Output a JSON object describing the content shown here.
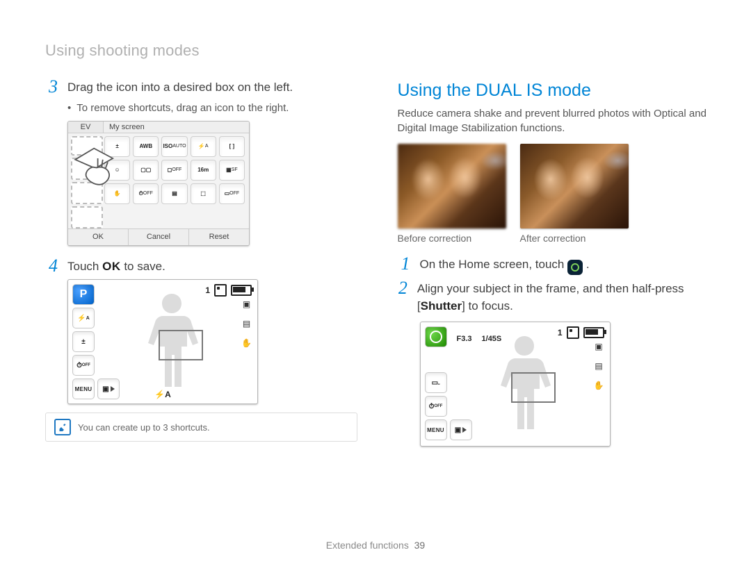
{
  "header": "Using shooting modes",
  "left": {
    "step3": {
      "num": "3",
      "text": "Drag the icon into a desired box on the left.",
      "bullet": "To remove shortcuts, drag an icon to the right."
    },
    "myscreen": {
      "ev": "EV",
      "title": "My screen",
      "buttons": {
        "ok": "OK",
        "cancel": "Cancel",
        "reset": "Reset"
      },
      "icons": [
        "EV",
        "AWB",
        "ISO",
        "flash",
        "focus",
        "face",
        "drive",
        "off",
        "16m",
        "size",
        "dual",
        "timer",
        "pal",
        "area",
        "off2"
      ]
    },
    "step4": {
      "num": "4",
      "text_before": "Touch ",
      "ok": "OK",
      "text_after": " to save."
    },
    "lcd1": {
      "mode": "P",
      "menu": "MENU",
      "count": "1",
      "flash": "⚡A"
    },
    "note": "You can create up to 3 shortcuts."
  },
  "right": {
    "title": "Using the DUAL IS mode",
    "desc": "Reduce camera shake and prevent blurred photos with Optical and Digital Image Stabilization functions.",
    "captions": {
      "before": "Before correction",
      "after": "After correction"
    },
    "step1": {
      "num": "1",
      "text_before": "On the Home screen, touch ",
      "text_after": "."
    },
    "step2": {
      "num": "2",
      "text_before": "Align your subject in the frame, and then half-press [",
      "shutter": "Shutter",
      "text_after": "] to focus."
    },
    "lcd2": {
      "aperture": "F3.3",
      "shutter": "1/45S",
      "menu": "MENU",
      "count": "1"
    }
  },
  "footer": {
    "section": "Extended functions",
    "page": "39"
  }
}
